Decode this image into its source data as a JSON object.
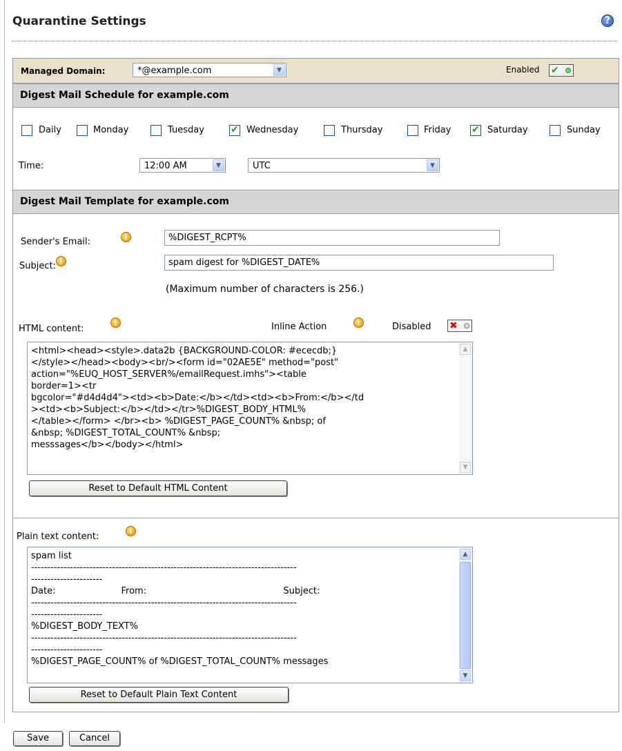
{
  "page": {
    "title": "Quarantine Settings",
    "help_icon": "help-icon"
  },
  "domain": {
    "label": "Managed Domain:",
    "selected": "*@example.com",
    "enabled_label": "Enabled",
    "enabled": true
  },
  "schedule": {
    "heading": "Digest Mail Schedule for example.com",
    "days": [
      {
        "label": "Daily",
        "checked": false
      },
      {
        "label": "Monday",
        "checked": false
      },
      {
        "label": "Tuesday",
        "checked": false
      },
      {
        "label": "Wednesday",
        "checked": true
      },
      {
        "label": "Thursday",
        "checked": false
      },
      {
        "label": "Friday",
        "checked": false
      },
      {
        "label": "Saturday",
        "checked": true
      },
      {
        "label": "Sunday",
        "checked": false
      }
    ],
    "time_label": "Time:",
    "time_value": "12:00 AM",
    "timezone_value": "UTC"
  },
  "template": {
    "heading": "Digest Mail Template for example.com",
    "sender_label": "Sender's Email:",
    "sender_value": "%DIGEST_RCPT%",
    "subject_label": "Subject:",
    "subject_value": "spam digest for %DIGEST_DATE%",
    "max_note": "(Maximum number of characters is 256.)",
    "html_label": "HTML content:",
    "inline_action_label": "Inline Action",
    "inline_status_label": "Disabled",
    "inline_enabled": false,
    "html_content": "<html><head><style>.data2b {BACKGROUND-COLOR: #ececdb;}\n</style></head><body><br/><form id=\"02AE5E\" method=\"post\"\naction=\"%EUQ_HOST_SERVER%/emailRequest.imhs\"><table\nborder=1><tr\nbgcolor=\"#d4d4d4\"><td><b>Date:</b></td><td><b>From:</b></td\n><td><b>Subject:</b></td></tr>%DIGEST_BODY_HTML%\n</table></form> </br><b> %DIGEST_PAGE_COUNT% &nbsp; of\n&nbsp; %DIGEST_TOTAL_COUNT% &nbsp;\nmesssages</b></body></html>",
    "reset_html_label": "Reset to Default HTML Content",
    "plain_label": "Plain text content:",
    "plain_content": "spam list\n----------------------------------------------------------------------------------\n----------------------\nDate:                       From:                                                Subject:\n----------------------------------------------------------------------------------\n----------------------\n%DIGEST_BODY_TEXT%\n----------------------------------------------------------------------------------\n----------------------\n%DIGEST_PAGE_COUNT% of %DIGEST_TOTAL_COUNT% messages",
    "reset_plain_label": "Reset to Default Plain Text Content"
  },
  "actions": {
    "save_label": "Save",
    "cancel_label": "Cancel"
  },
  "colors": {
    "domain_bar": "#e6e2cc",
    "section_header": "#d6d6d6",
    "check_green": "#2b9a2b",
    "disabled_red": "#cc1111"
  }
}
